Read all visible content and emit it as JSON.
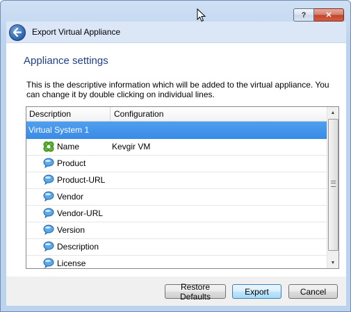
{
  "window": {
    "help_label": "?",
    "close_label": "✕"
  },
  "nav": {
    "title": "Export Virtual Appliance"
  },
  "page": {
    "heading": "Appliance settings",
    "description": "This is the descriptive information which will be added to the virtual appliance. You can change it by double clicking on individual lines."
  },
  "table": {
    "columns": [
      "Description",
      "Configuration"
    ],
    "group": "Virtual System 1",
    "rows": [
      {
        "label": "Name",
        "value": "Kevgir VM",
        "icon": "puzzle-icon"
      },
      {
        "label": "Product",
        "value": "",
        "icon": "speech-bubble-icon"
      },
      {
        "label": "Product-URL",
        "value": "",
        "icon": "speech-bubble-icon"
      },
      {
        "label": "Vendor",
        "value": "",
        "icon": "speech-bubble-icon"
      },
      {
        "label": "Vendor-URL",
        "value": "",
        "icon": "speech-bubble-icon"
      },
      {
        "label": "Version",
        "value": "",
        "icon": "speech-bubble-icon"
      },
      {
        "label": "Description",
        "value": "",
        "icon": "speech-bubble-icon"
      },
      {
        "label": "License",
        "value": "",
        "icon": "speech-bubble-icon"
      }
    ]
  },
  "buttons": {
    "restore": "Restore Defaults",
    "export": "Export",
    "cancel": "Cancel"
  },
  "colors": {
    "accent": "#3a8be6",
    "heading": "#1e3f8a"
  }
}
